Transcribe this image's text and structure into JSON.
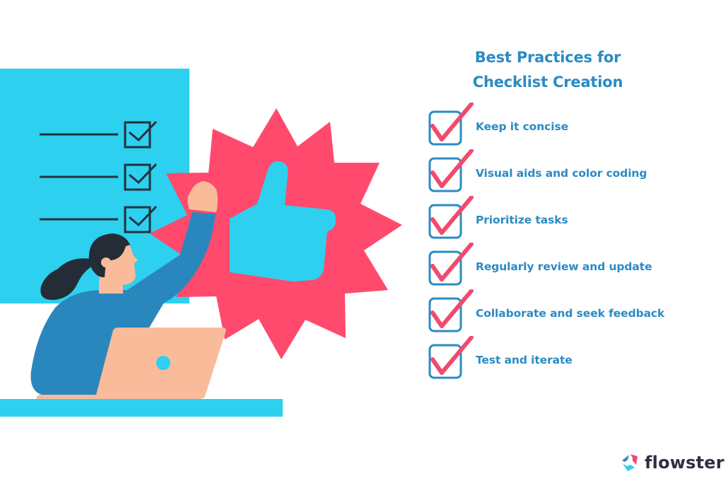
{
  "title": {
    "line1": "Best Practices for",
    "line2": "Checklist Creation"
  },
  "checklist": [
    {
      "label": "Keep it concise",
      "checked": true
    },
    {
      "label": "Visual aids and color coding",
      "checked": true
    },
    {
      "label": "Prioritize tasks",
      "checked": true
    },
    {
      "label": "Regularly review and update",
      "checked": true
    },
    {
      "label": "Collaborate and seek feedback",
      "checked": true
    },
    {
      "label": "Test and iterate",
      "checked": true
    }
  ],
  "illustration": {
    "board_items": 3,
    "icons": [
      "checklist-board",
      "starburst",
      "thumbs-up-icon",
      "woman-cheering",
      "laptop"
    ]
  },
  "brand": {
    "name": "flowster"
  },
  "colors": {
    "text_blue": "#2a8bc4",
    "check_pink": "#f04a6e",
    "board_cyan": "#2dd0ef",
    "starburst_red": "#ff4a6d",
    "sweater_blue": "#2a87bd",
    "skin": "#f9bb9a",
    "hair": "#242c37",
    "brand_dark": "#2b3140"
  }
}
